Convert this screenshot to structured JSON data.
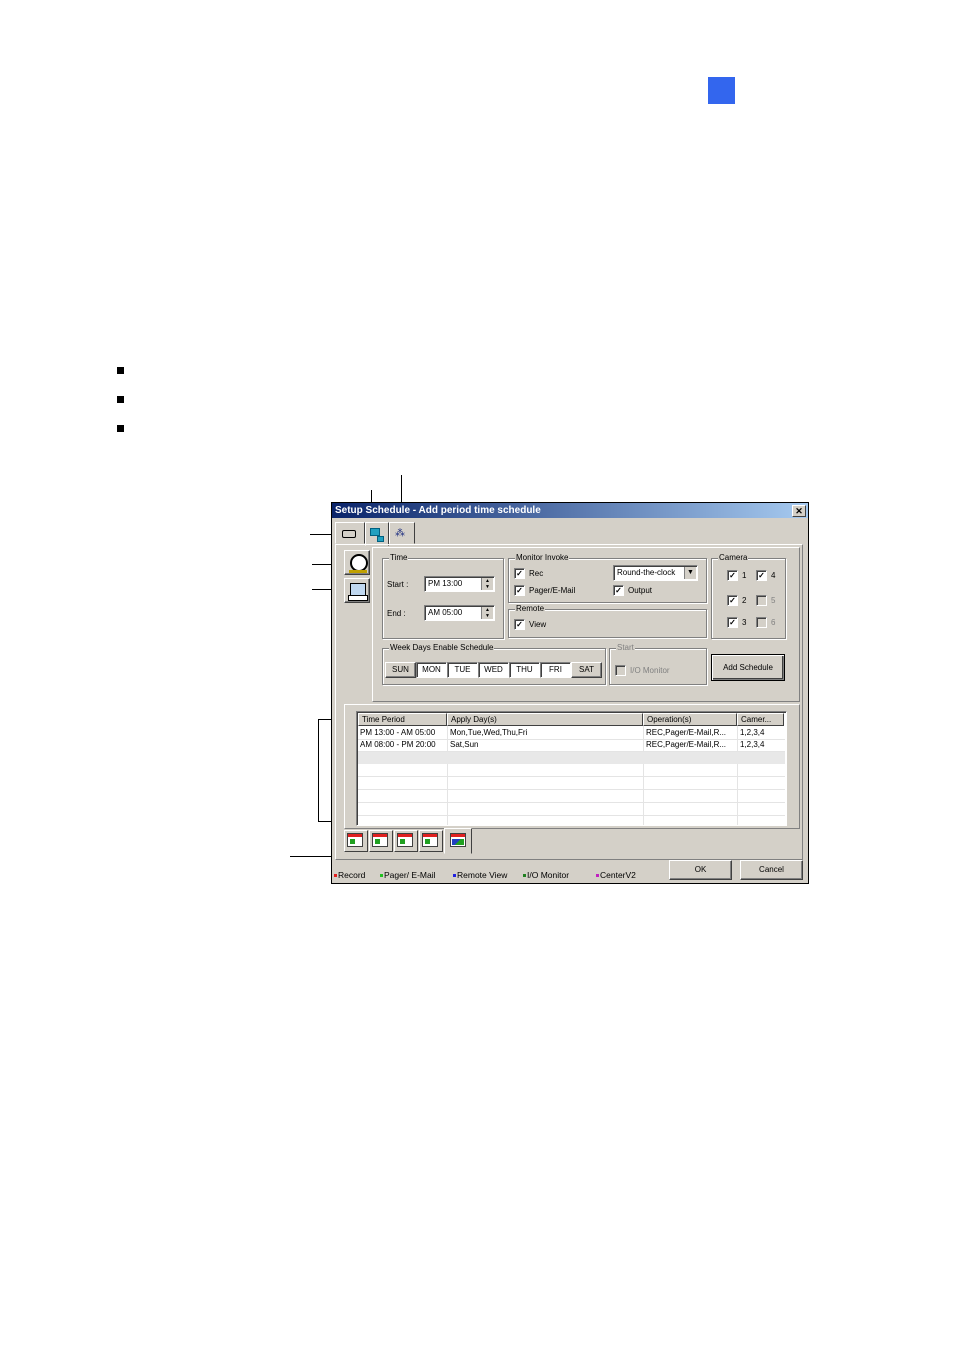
{
  "dialog": {
    "title": "Setup Schedule - Add period time schedule",
    "close_glyph": "✕",
    "time_group": {
      "legend": "Time",
      "start_label": "Start :",
      "start_value": "PM 13:00",
      "end_label": "End :",
      "end_value": "AM 05:00"
    },
    "monitor_invoke": {
      "legend": "Monitor Invoke",
      "rec_label": "Rec",
      "rec_checked": true,
      "pager_label": "Pager/E-Mail",
      "pager_checked": true,
      "output_label": "Output",
      "output_checked": true,
      "mode_value": "Round-the-clock"
    },
    "remote": {
      "legend": "Remote",
      "view_label": "View",
      "view_checked": true
    },
    "camera": {
      "legend": "Camera",
      "items": [
        {
          "label": "1",
          "checked": true,
          "enabled": true
        },
        {
          "label": "4",
          "checked": true,
          "enabled": true
        },
        {
          "label": "2",
          "checked": true,
          "enabled": true
        },
        {
          "label": "5",
          "checked": false,
          "enabled": false
        },
        {
          "label": "3",
          "checked": true,
          "enabled": true
        },
        {
          "label": "6",
          "checked": false,
          "enabled": false
        }
      ]
    },
    "weekdays": {
      "legend": "Week Days Enable Schedule",
      "days": [
        {
          "label": "SUN",
          "selected": false
        },
        {
          "label": "MON",
          "selected": true
        },
        {
          "label": "TUE",
          "selected": true
        },
        {
          "label": "WED",
          "selected": true
        },
        {
          "label": "THU",
          "selected": true
        },
        {
          "label": "FRI",
          "selected": true
        },
        {
          "label": "SAT",
          "selected": false
        }
      ]
    },
    "start_group": {
      "legend": "Start",
      "io_monitor_label": "I/O Monitor"
    },
    "add_schedule_label": "Add Schedule",
    "table": {
      "columns": [
        "Time Period",
        "Apply Day(s)",
        "Operation(s)",
        "Camer..."
      ],
      "rows": [
        [
          "PM 13:00 - AM 05:00",
          "Mon,Tue,Wed,Thu,Fri",
          "REC,Pager/E-Mail,R...",
          "1,2,3,4"
        ],
        [
          "AM 08:00 - PM 20:00",
          "Sat,Sun",
          "REC,Pager/E-Mail,R...",
          "1,2,3,4"
        ]
      ]
    },
    "ok_label": "OK",
    "cancel_label": "Cancel",
    "legend_items": [
      {
        "label": "Record",
        "color": "#e02020"
      },
      {
        "label": "Pager/ E-Mail",
        "color": "#20c020"
      },
      {
        "label": "Remote View",
        "color": "#2020e0"
      },
      {
        "label": "I/O Monitor",
        "color": "#208020"
      },
      {
        "label": "CenterV2",
        "color": "#c020c0"
      }
    ]
  },
  "colors": {
    "accent_square": "#3366ee",
    "title_gradient_start": "#0a246a",
    "title_gradient_end": "#a6caf0",
    "dialog_face": "#d4d0c8"
  }
}
